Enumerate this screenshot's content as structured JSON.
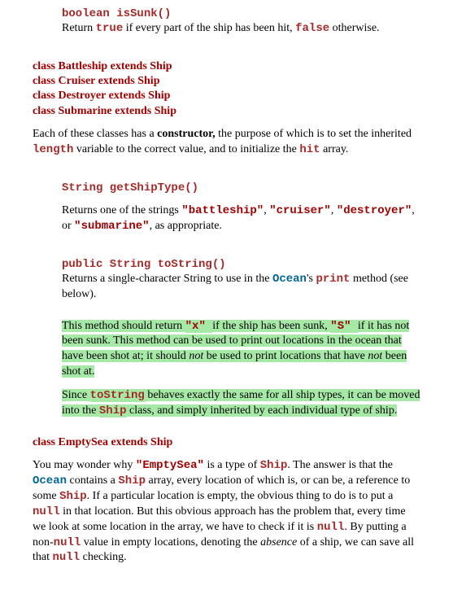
{
  "isSunk": {
    "sig": "boolean isSunk()",
    "desc_a": "Return ",
    "desc_true": "true",
    "desc_b": " if every part of the ship has been hit, ",
    "desc_false": "false",
    "desc_c": " otherwise."
  },
  "subclasses": {
    "l1": "class Battleship extends Ship",
    "l2": "class Cruiser extends Ship",
    "l3": "class Destroyer extends Ship",
    "l4": "class Submarine extends Ship",
    "para_a": "Each of these classes has a ",
    "para_bold": "constructor,",
    "para_b": " the purpose of which is to set the inherited ",
    "para_len": "length",
    "para_c": " variable to the correct value, and to initialize the ",
    "para_hit": "hit",
    "para_d": " array."
  },
  "getShipType": {
    "sig": "String getShipType()",
    "a": "Returns one of the strings ",
    "s1": "\"battleship\"",
    "c1": ", ",
    "s2": "\"cruiser\"",
    "c2": ", ",
    "s3": "\"destroyer\"",
    "c3": ", or ",
    "s4": "\"submarine\"",
    "end": ", as appropriate."
  },
  "toString": {
    "sig": "public String toString()",
    "desc_a": "Returns a single-character String to use in the ",
    "ocean": "Ocean",
    "desc_b": "'s ",
    "print": "print",
    "desc_c": " method (see below).",
    "hl1_a": "This method should return ",
    "hl1_x": " \"x\" ",
    "hl1_b": "if the ship has been sunk, ",
    "hl1_s": "\"S\" ",
    "hl1_c": "if it has not been sunk. This method can be used to print out locations in the ocean that have been shot at; it should ",
    "hl1_not": "not",
    "hl1_d": " be used to print locations that have ",
    "hl1_not2": "not",
    "hl1_e": " been shot at.",
    "hl2_a": "Since ",
    "hl2_ts": "toString",
    "hl2_b": " behaves exactly the same for all ship types, it can be moved into the ",
    "hl2_ship": "Ship",
    "hl2_c": " class, and simply inherited by each individual type of ship."
  },
  "emptySea": {
    "hdr": "class EmptySea extends Ship",
    "a": "You may wonder why ",
    "es": "\"EmptySea\"",
    "b": " is a type of ",
    "ship": "Ship",
    "c": ". The answer is that the ",
    "ocean": "Ocean",
    "d": " contains a ",
    "ship2": "Ship",
    "e": " array, every location of which is, or can be, a reference to some ",
    "ship3": "Ship",
    "f": ". If a particular location is empty, the obvious thing to do is to put a ",
    "null1": "null",
    "g": " in that location. But this obvious approach has the problem that, every time we look at some location in the array, we have to check if it is ",
    "null2": "null",
    "h": ". By putting a non-",
    "null3": "null",
    "i": " value in empty locations, denoting the ",
    "absence": "absence",
    "j": " of a ship, we can save all that ",
    "null4": "null",
    "k": " checking."
  }
}
